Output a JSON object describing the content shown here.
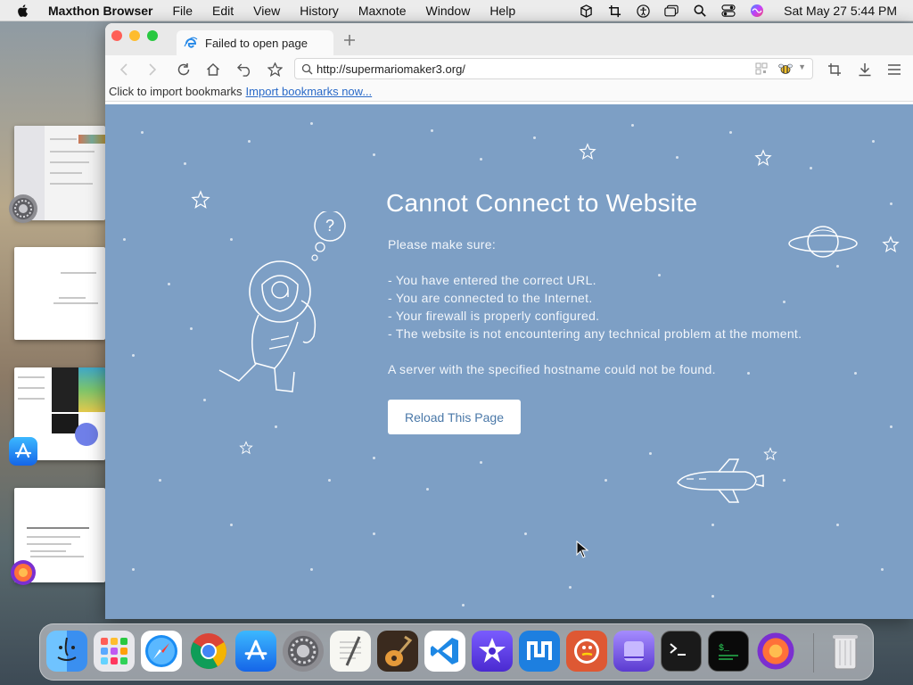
{
  "menubar": {
    "app_name": "Maxthon Browser",
    "menus": [
      "File",
      "Edit",
      "View",
      "History",
      "Maxnote",
      "Window",
      "Help"
    ],
    "clock": "Sat May 27  5:44 PM",
    "status_icons": [
      "cube-icon",
      "crop-icon",
      "accessibility-icon",
      "window-icon",
      "search-icon",
      "control-center-icon",
      "siri-icon"
    ]
  },
  "browser": {
    "tab_title": "Failed to open page",
    "url": "http://supermariomaker3.org/",
    "bookmarks_prompt": "Click to import bookmarks",
    "bookmarks_link": "Import bookmarks now..."
  },
  "error_page": {
    "title": "Cannot Connect to Website",
    "intro": "Please make sure:",
    "checks": [
      "- You have entered the correct URL.",
      "- You are connected to the Internet.",
      "- Your firewall is properly configured.",
      "- The website is not encountering any technical problem at the moment."
    ],
    "detail": "A server with the specified hostname could not be found.",
    "reload_label": "Reload This Page",
    "thought_bubble": "?"
  },
  "colors": {
    "error_bg": "#7d9fc5",
    "link": "#2a6ac8",
    "button_text": "#4a78a8"
  },
  "dock": {
    "apps": [
      "finder",
      "launchpad",
      "safari",
      "chrome",
      "app-store",
      "system-settings",
      "textedit",
      "garageband",
      "vscode",
      "imovie",
      "maxthon",
      "duckduckgo",
      "apple-configurator",
      "terminal",
      "script-editor",
      "firefox",
      "trash"
    ]
  }
}
